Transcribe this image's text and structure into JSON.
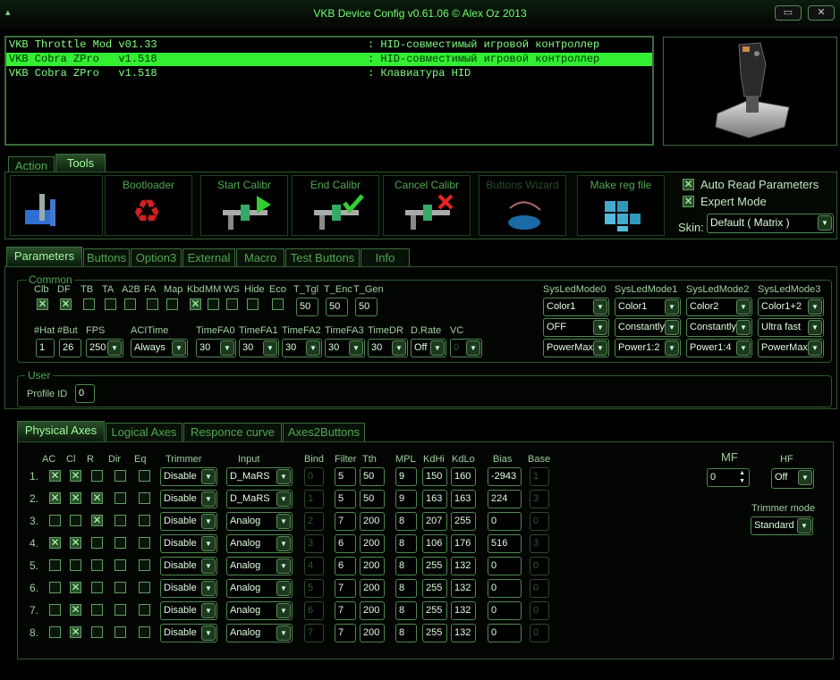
{
  "app": {
    "title": "VKB Device Config v0.61.06 © Alex Oz 2013",
    "minimize_icon": "minimize-icon",
    "close_icon": "close-icon"
  },
  "devices": [
    {
      "name": "VKB Throttle Mod v01.33",
      "desc": ": HID-совместимый игровой контроллер"
    },
    {
      "name": "VKB Cobra ZPro   v1.518",
      "desc": ": HID-совместимый игровой контроллер"
    },
    {
      "name": "VKB Cobra ZPro   v1.518",
      "desc": ": Клавиатура HID"
    }
  ],
  "main_tabs": [
    "Action",
    "Tools"
  ],
  "tools": {
    "bootloader": "Bootloader",
    "start_calibr": "Start Calibr",
    "end_calibr": "End Calibr",
    "cancel_calibr": "Cancel Calibr",
    "buttons_wizard": "Buttons Wizard",
    "make_reg": "Make reg file",
    "auto_read": "Auto Read Parameters",
    "expert": "Expert Mode",
    "skin_label": "Skin:",
    "skin_value": "Default ( Matrix )"
  },
  "param_tabs": [
    "Parameters",
    "Buttons",
    "Option3",
    "External",
    "Macro",
    "Test Buttons",
    "Info"
  ],
  "common": {
    "title": "Common",
    "flags": [
      {
        "l": "Clb",
        "v": true
      },
      {
        "l": "DF",
        "v": true
      },
      {
        "l": "TB",
        "v": false
      },
      {
        "l": "TA",
        "v": false
      },
      {
        "l": "A2B",
        "v": false
      },
      {
        "l": "FA",
        "v": false
      },
      {
        "l": "Map",
        "v": false
      },
      {
        "l": "Kbd",
        "v": true
      },
      {
        "l": "MM",
        "v": false
      },
      {
        "l": "WS",
        "v": false
      },
      {
        "l": "Hide",
        "v": false
      },
      {
        "l": "Eco",
        "v": false
      }
    ],
    "t_tgl_label": "T_Tgl",
    "t_tgl": "50",
    "t_enc_label": "T_Enc",
    "t_enc": "50",
    "t_gen_label": "T_Gen",
    "t_gen": "50",
    "hat_label": "#Hat",
    "hat": "1",
    "but_label": "#But",
    "but": "26",
    "fps_label": "FPS",
    "fps": "250",
    "acitime_label": "ACITime",
    "acitime": "Always",
    "tfa": [
      {
        "l": "TimeFA0",
        "v": "30"
      },
      {
        "l": "TimeFA1",
        "v": "30"
      },
      {
        "l": "TimeFA2",
        "v": "30"
      },
      {
        "l": "TimeFA3",
        "v": "30"
      },
      {
        "l": "TimeDR",
        "v": "30"
      }
    ],
    "drate_label": "D.Rate",
    "drate": "Off",
    "vc_label": "VC",
    "vc": "0",
    "sysled": [
      {
        "t": "SysLedMode0",
        "v": [
          "Color1",
          "OFF",
          "PowerMax"
        ]
      },
      {
        "t": "SysLedMode1",
        "v": [
          "Color1",
          "Constantly",
          "Power1:2"
        ]
      },
      {
        "t": "SysLedMode2",
        "v": [
          "Color2",
          "Constantly",
          "Power1:4"
        ]
      },
      {
        "t": "SysLedMode3",
        "v": [
          "Color1+2",
          "Ultra fast",
          "PowerMax"
        ]
      }
    ]
  },
  "user": {
    "title": "User",
    "profile_label": "Profile ID",
    "profile": "0"
  },
  "axes_tabs": [
    "Physical Axes",
    "Logical Axes",
    "Responce curve",
    "Axes2Buttons"
  ],
  "axes_headers": {
    "ac": "AC",
    "cl": "Cl",
    "r": "R",
    "dir": "Dir",
    "eq": "Eq",
    "trimmer": "Trimmer",
    "input": "Input",
    "bind": "Bind",
    "filter": "Filter",
    "tth": "Tth",
    "mpl": "MPL",
    "kdhi": "KdHi",
    "kdlo": "KdLo",
    "bias": "Bias",
    "base": "Base"
  },
  "axes": [
    {
      "n": "1.",
      "ac": true,
      "cl": true,
      "r": false,
      "dir": false,
      "eq": false,
      "trimmer": "Disable",
      "input": "D_MaRS",
      "bind": "0",
      "filter": "5",
      "tth": "50",
      "mpl": "9",
      "kdhi": "150",
      "kdlo": "160",
      "bias": "-2943",
      "base": "1"
    },
    {
      "n": "2.",
      "ac": true,
      "cl": true,
      "r": true,
      "dir": false,
      "eq": false,
      "trimmer": "Disable",
      "input": "D_MaRS",
      "bind": "1",
      "filter": "5",
      "tth": "50",
      "mpl": "9",
      "kdhi": "163",
      "kdlo": "163",
      "bias": "224",
      "base": "3"
    },
    {
      "n": "3.",
      "ac": false,
      "cl": false,
      "r": true,
      "dir": false,
      "eq": false,
      "trimmer": "Disable",
      "input": "Analog",
      "bind": "2",
      "filter": "7",
      "tth": "200",
      "mpl": "8",
      "kdhi": "207",
      "kdlo": "255",
      "bias": "0",
      "base": "0"
    },
    {
      "n": "4.",
      "ac": true,
      "cl": true,
      "r": false,
      "dir": false,
      "eq": false,
      "trimmer": "Disable",
      "input": "Analog",
      "bind": "3",
      "filter": "6",
      "tth": "200",
      "mpl": "8",
      "kdhi": "106",
      "kdlo": "176",
      "bias": "516",
      "base": "3"
    },
    {
      "n": "5.",
      "ac": false,
      "cl": false,
      "r": false,
      "dir": false,
      "eq": false,
      "trimmer": "Disable",
      "input": "Analog",
      "bind": "4",
      "filter": "6",
      "tth": "200",
      "mpl": "8",
      "kdhi": "255",
      "kdlo": "132",
      "bias": "0",
      "base": "0"
    },
    {
      "n": "6.",
      "ac": false,
      "cl": true,
      "r": false,
      "dir": false,
      "eq": false,
      "trimmer": "Disable",
      "input": "Analog",
      "bind": "5",
      "filter": "7",
      "tth": "200",
      "mpl": "8",
      "kdhi": "255",
      "kdlo": "132",
      "bias": "0",
      "base": "0"
    },
    {
      "n": "7.",
      "ac": false,
      "cl": true,
      "r": false,
      "dir": false,
      "eq": false,
      "trimmer": "Disable",
      "input": "Analog",
      "bind": "6",
      "filter": "7",
      "tth": "200",
      "mpl": "8",
      "kdhi": "255",
      "kdlo": "132",
      "bias": "0",
      "base": "0"
    },
    {
      "n": "8.",
      "ac": false,
      "cl": true,
      "r": false,
      "dir": false,
      "eq": false,
      "trimmer": "Disable",
      "input": "Analog",
      "bind": "7",
      "filter": "7",
      "tth": "200",
      "mpl": "8",
      "kdhi": "255",
      "kdlo": "132",
      "bias": "0",
      "base": "0"
    }
  ],
  "mf": {
    "label": "MF",
    "value": "0"
  },
  "hf": {
    "label": "HF",
    "value": "Off"
  },
  "trimmer_mode": {
    "label": "Trimmer mode",
    "value": "Standard"
  }
}
